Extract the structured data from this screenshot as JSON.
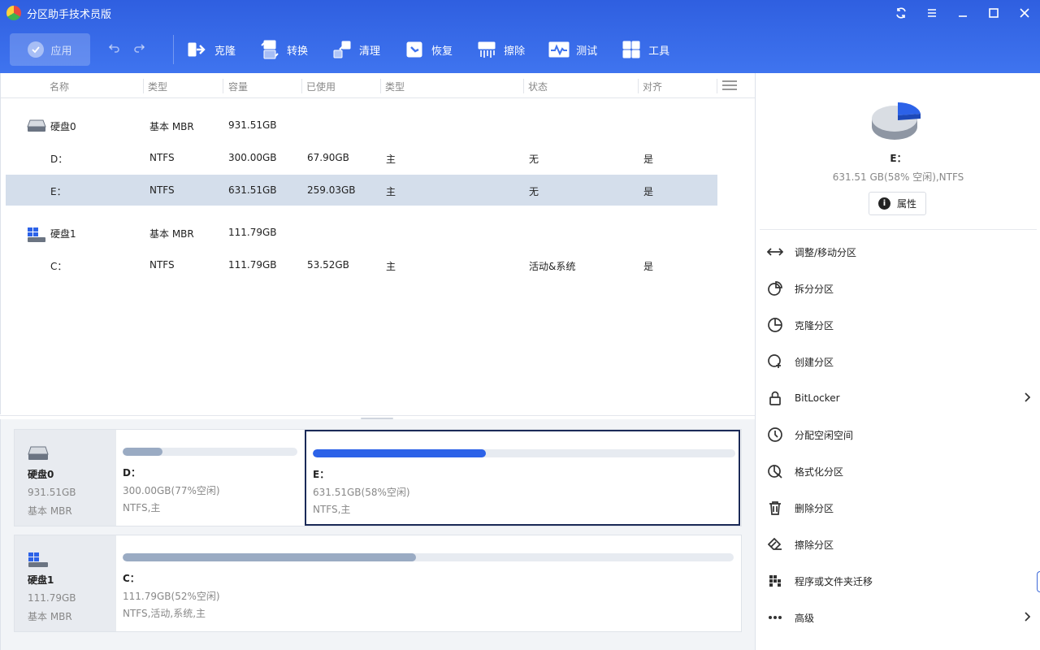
{
  "app": {
    "title": "分区助手技术员版"
  },
  "toolbar": {
    "apply_label": "应用",
    "tools": [
      {
        "label": "克隆",
        "icon": "clone-icon"
      },
      {
        "label": "转换",
        "icon": "convert-icon"
      },
      {
        "label": "清理",
        "icon": "clean-icon"
      },
      {
        "label": "恢复",
        "icon": "recover-icon"
      },
      {
        "label": "擦除",
        "icon": "wipe-icon"
      },
      {
        "label": "测试",
        "icon": "test-icon"
      },
      {
        "label": "工具",
        "icon": "tools-icon"
      }
    ]
  },
  "table": {
    "columns": [
      "名称",
      "类型",
      "容量",
      "已使用",
      "类型",
      "状态",
      "对齐"
    ],
    "disks": [
      {
        "name": "硬盘0",
        "type": "基本 MBR",
        "capacity": "931.51GB",
        "partitions": [
          {
            "name": "D：",
            "fs": "NTFS",
            "capacity": "300.00GB",
            "used": "67.90GB",
            "ptype": "主",
            "status": "无",
            "align": "是",
            "selected": false
          },
          {
            "name": "E：",
            "fs": "NTFS",
            "capacity": "631.51GB",
            "used": "259.03GB",
            "ptype": "主",
            "status": "无",
            "align": "是",
            "selected": true
          }
        ]
      },
      {
        "name": "硬盘1",
        "type": "基本 MBR",
        "capacity": "111.79GB",
        "partitions": [
          {
            "name": "C：",
            "fs": "NTFS",
            "capacity": "111.79GB",
            "used": "53.52GB",
            "ptype": "主",
            "status": "活动&系统",
            "align": "是",
            "selected": false
          }
        ]
      }
    ]
  },
  "diskmap": [
    {
      "name": "硬盘0",
      "capacity": "931.51GB",
      "type": "基本 MBR",
      "partitions": [
        {
          "label": "D：",
          "size_info": "300.00GB(77%空闲)",
          "fs_info": "NTFS,主",
          "used_fraction": 0.23,
          "selected": false
        },
        {
          "label": "E：",
          "size_info": "631.51GB(58%空闲)",
          "fs_info": "NTFS,主",
          "used_fraction": 0.41,
          "selected": true
        }
      ]
    },
    {
      "name": "硬盘1",
      "capacity": "111.79GB",
      "type": "基本 MBR",
      "partitions": [
        {
          "label": "C：",
          "size_info": "111.79GB(52%空闲)",
          "fs_info": "NTFS,活动,系统,主",
          "used_fraction": 0.48,
          "selected": false
        }
      ]
    }
  ],
  "right_panel": {
    "name": "E：",
    "info": "631.51 GB(58% 空闲),NTFS",
    "properties_label": "属性",
    "operations": [
      {
        "label": "调整/移动分区",
        "icon": "resize-icon"
      },
      {
        "label": "拆分分区",
        "icon": "split-icon"
      },
      {
        "label": "克隆分区",
        "icon": "clone-partition-icon"
      },
      {
        "label": "创建分区",
        "icon": "create-icon"
      },
      {
        "label": "BitLocker",
        "icon": "lock-icon",
        "submenu": true
      },
      {
        "label": "分配空闲空间",
        "icon": "allocate-icon"
      },
      {
        "label": "格式化分区",
        "icon": "format-icon"
      },
      {
        "label": "删除分区",
        "icon": "trash-icon"
      },
      {
        "label": "擦除分区",
        "icon": "eraser-icon"
      },
      {
        "label": "程序或文件夹迁移",
        "icon": "migrate-icon"
      },
      {
        "label": "高级",
        "icon": "more-icon",
        "submenu": true
      }
    ]
  },
  "colors": {
    "accent": "#2f5fe0",
    "selected_row": "#d4deeb",
    "bar_selected": "#2c62e8",
    "bar_normal": "#9aabc3"
  }
}
